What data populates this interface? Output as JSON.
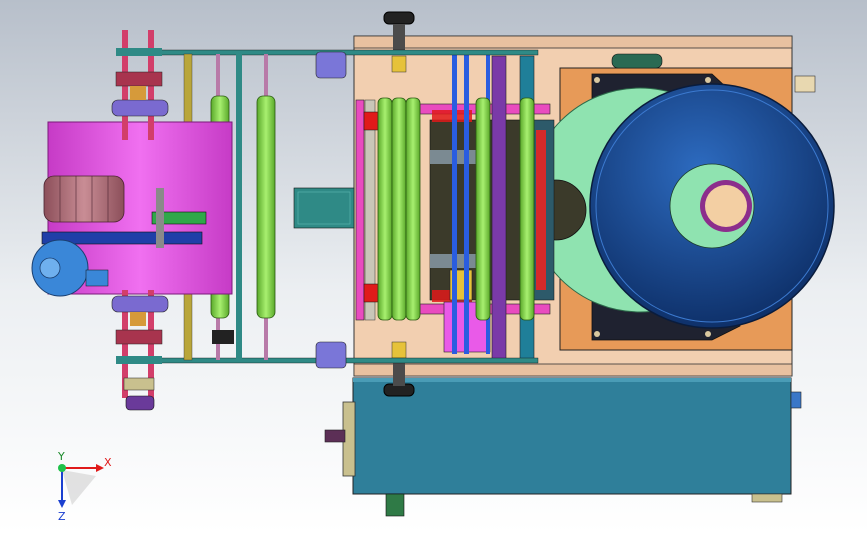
{
  "triad": {
    "x_label": "X",
    "y_label": "Y",
    "z_label": "Z"
  },
  "colors": {
    "background_top": "#b7bfca",
    "background_bottom": "#ffffff",
    "frame": "#f2cfb0",
    "roller_green": "#86e34a",
    "motor_magenta": "#e95ae8",
    "hopper_blue": "#1f4f96",
    "plate_orange": "#e79a58",
    "tank_teal": "#2f7f9a",
    "disc_mint": "#8fe3b0"
  }
}
